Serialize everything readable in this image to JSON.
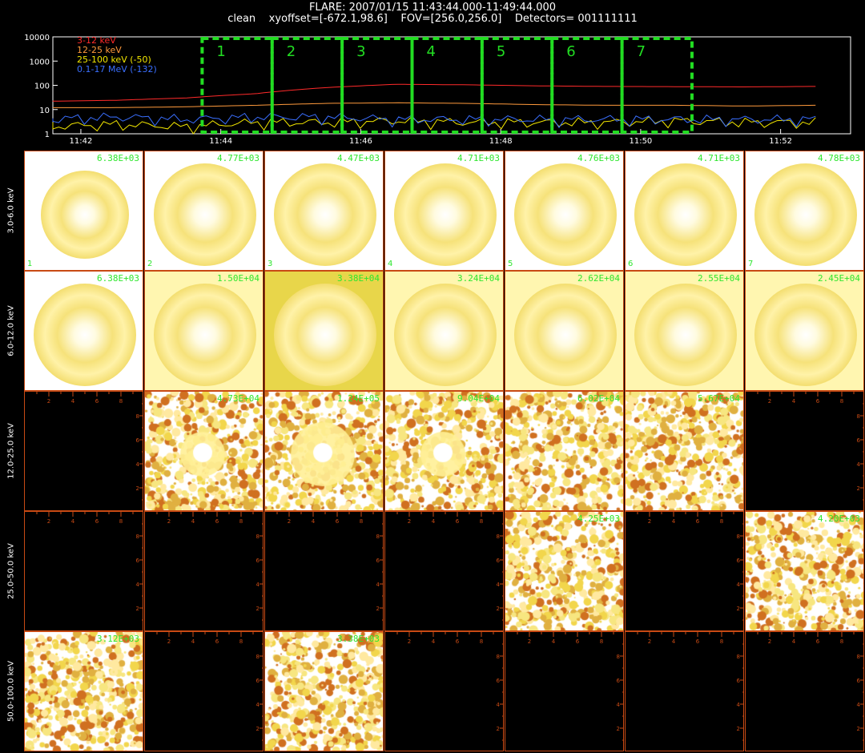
{
  "header": {
    "line1": "FLARE: 2007/01/15 11:43:44.000-11:49:44.000",
    "line2": "clean    xyoffset=[-672.1,98.6]    FOV=[256.0,256.0]    Detectors= 001111111"
  },
  "chart_data": [
    {
      "type": "line",
      "title": "",
      "x_ticks": [
        "11:42",
        "11:44",
        "11:46",
        "11:48",
        "11:50",
        "11:52"
      ],
      "y_ticks": [
        "1",
        "10",
        "100",
        "1000",
        "10000"
      ],
      "y_scale": "log",
      "ylim": [
        1,
        10000
      ],
      "xlim_minutes": [
        11.6,
        12.0
      ],
      "series": [
        {
          "name": "3-12 keV",
          "color": "#ff2a2a",
          "x": [
            "11:41:30",
            "11:42:30",
            "11:43:30",
            "11:44:30",
            "11:45:30",
            "11:46:30",
            "11:47:30",
            "11:48:30",
            "11:49:30",
            "11:50:30",
            "11:51:30",
            "11:52:30"
          ],
          "y": [
            22,
            24,
            30,
            45,
            80,
            110,
            105,
            95,
            90,
            88,
            86,
            90
          ]
        },
        {
          "name": "12-25 keV",
          "color": "#ff9a3c",
          "x": [
            "11:41:30",
            "11:42:30",
            "11:43:30",
            "11:44:30",
            "11:45:30",
            "11:46:30",
            "11:47:30",
            "11:48:30",
            "11:49:30",
            "11:50:30",
            "11:51:30",
            "11:52:30"
          ],
          "y": [
            12,
            12,
            13,
            15,
            18,
            19,
            18,
            16,
            15,
            15,
            14,
            15
          ]
        },
        {
          "name": "25-100 keV (-50)",
          "color": "#f2e600",
          "x": [
            "11:41:30",
            "11:42:30",
            "11:43:30",
            "11:44:30",
            "11:45:30",
            "11:46:30",
            "11:47:30",
            "11:48:30",
            "11:49:30",
            "11:50:30",
            "11:51:30",
            "11:52:30"
          ],
          "y": [
            2,
            2.5,
            2,
            3,
            3,
            3.5,
            3,
            3,
            3,
            3.5,
            3,
            3
          ]
        },
        {
          "name": "0.1-17 MeV (-132)",
          "color": "#3a6fff",
          "x": [
            "11:41:30",
            "11:42:30",
            "11:43:30",
            "11:44:30",
            "11:45:30",
            "11:46:30",
            "11:47:30",
            "11:48:30",
            "11:49:30",
            "11:50:30",
            "11:51:30",
            "11:52:30"
          ],
          "y": [
            4,
            5,
            4,
            5,
            5,
            4,
            4,
            4,
            4,
            4,
            4,
            4
          ]
        }
      ],
      "intervals": [
        {
          "label": "1"
        },
        {
          "label": "2"
        },
        {
          "label": "3"
        },
        {
          "label": "4"
        },
        {
          "label": "5"
        },
        {
          "label": "6"
        },
        {
          "label": "7"
        }
      ],
      "interval_color": "#22dd22"
    },
    {
      "type": "heatmap",
      "row_labels": [
        "3.0-6.0 keV",
        "6.0-12.0 keV",
        "12.0-25.0 keV",
        "25.0-50.0 keV",
        "50.0-100.0 keV"
      ],
      "column_labels": [
        "1",
        "2",
        "3",
        "4",
        "5",
        "6",
        "7"
      ],
      "panels": [
        [
          "6.38E+03",
          "4.77E+03",
          "4.47E+03",
          "4.71E+03",
          "4.76E+03",
          "4.71E+03",
          "4.78E+03"
        ],
        [
          "6.38E+03",
          "1.50E+04",
          "3.38E+04",
          "3.24E+04",
          "2.62E+04",
          "2.55E+04",
          "2.45E+04"
        ],
        [
          "",
          "4.73E+04",
          "1.24E+05",
          "9.04E+04",
          "6.02E+04",
          "5.67E+04",
          ""
        ],
        [
          "",
          "",
          "",
          "",
          "4.25E+03",
          "",
          "4.20E+03"
        ],
        [
          "3.12E+03",
          "",
          "3.38E+03",
          "",
          "",
          "",
          ""
        ]
      ],
      "panel_style": [
        [
          "ring",
          "ring",
          "ring",
          "ring",
          "ring",
          "ring",
          "ring"
        ],
        [
          "ring",
          "ring",
          "ring",
          "ring",
          "ring",
          "ring",
          "ring"
        ],
        [
          "black",
          "noise",
          "noise",
          "noise",
          "noise",
          "noise",
          "black"
        ],
        [
          "black",
          "black",
          "black",
          "black",
          "noise",
          "black",
          "noise"
        ],
        [
          "noise",
          "black",
          "noise",
          "black",
          "black",
          "black",
          "black"
        ]
      ],
      "axis_tick_labels": [
        "2",
        "4",
        "6",
        "8"
      ]
    }
  ]
}
